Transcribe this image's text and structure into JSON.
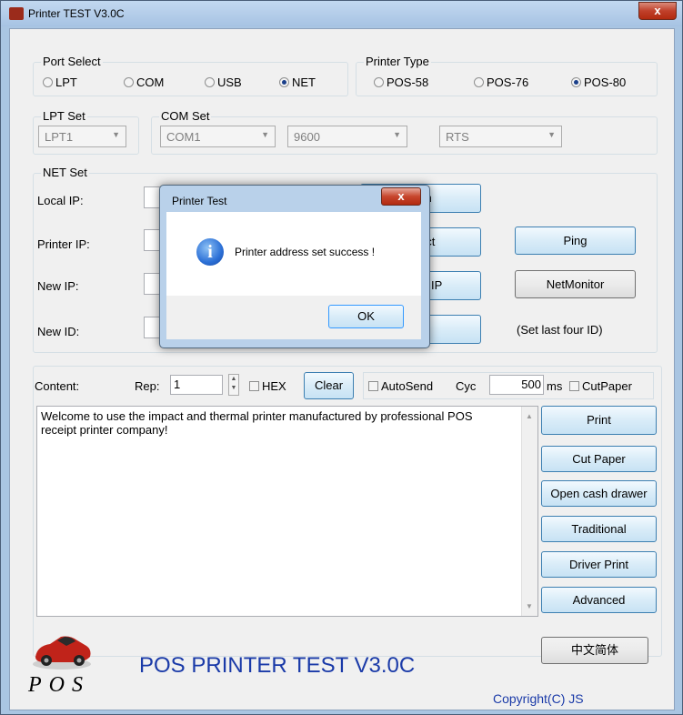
{
  "window": {
    "title": "Printer TEST V3.0C",
    "close_label": "x"
  },
  "port_select": {
    "title": "Port Select",
    "options": [
      "LPT",
      "COM",
      "USB",
      "NET"
    ],
    "selected": "NET"
  },
  "printer_type": {
    "title": "Printer Type",
    "options": [
      "POS-58",
      "POS-76",
      "POS-80"
    ],
    "selected": "POS-80"
  },
  "lpt_set": {
    "title": "LPT Set",
    "value": "LPT1"
  },
  "com_set": {
    "title": "COM Set",
    "port": "COM1",
    "baud": "9600",
    "flow": "RTS"
  },
  "net_set": {
    "title": "NET Set",
    "local_ip_label": "Local IP:",
    "printer_ip_label": "Printer IP:",
    "new_ip_label": "New IP:",
    "new_id_label": "New ID:",
    "refresh_label": "sh",
    "connect_label": "ect",
    "set_ip_label": "w IP",
    "set_id_label": "D",
    "ping_label": "Ping",
    "netmonitor_label": "NetMonitor",
    "hint": "(Set last four ID)"
  },
  "content": {
    "label": "Content:",
    "rep_label": "Rep:",
    "rep_value": "1",
    "hex_label": "HEX",
    "clear_label": "Clear",
    "autosend_label": "AutoSend",
    "cyc_label": "Cyc",
    "cyc_value": "500",
    "ms_label": "ms",
    "cutpaper_label": "CutPaper",
    "text": "Welcome to use the impact and thermal printer manufactured by professional POS receipt printer company!"
  },
  "actions": {
    "print": "Print",
    "cut_paper": "Cut Paper",
    "open_drawer": "Open cash drawer",
    "traditional": "Traditional",
    "driver_print": "Driver Print",
    "advanced": "Advanced",
    "chinese": "中文简体"
  },
  "footer": {
    "title": "POS PRINTER TEST V3.0C",
    "copyright": "Copyright(C) JS",
    "logo_text": "POS"
  },
  "dialog": {
    "title": "Printer Test",
    "close_label": "x",
    "message": "Printer address set success !",
    "ok_label": "OK"
  },
  "colors": {
    "accent": "#1a3aa8",
    "title_bar": "#a7c3e3"
  }
}
